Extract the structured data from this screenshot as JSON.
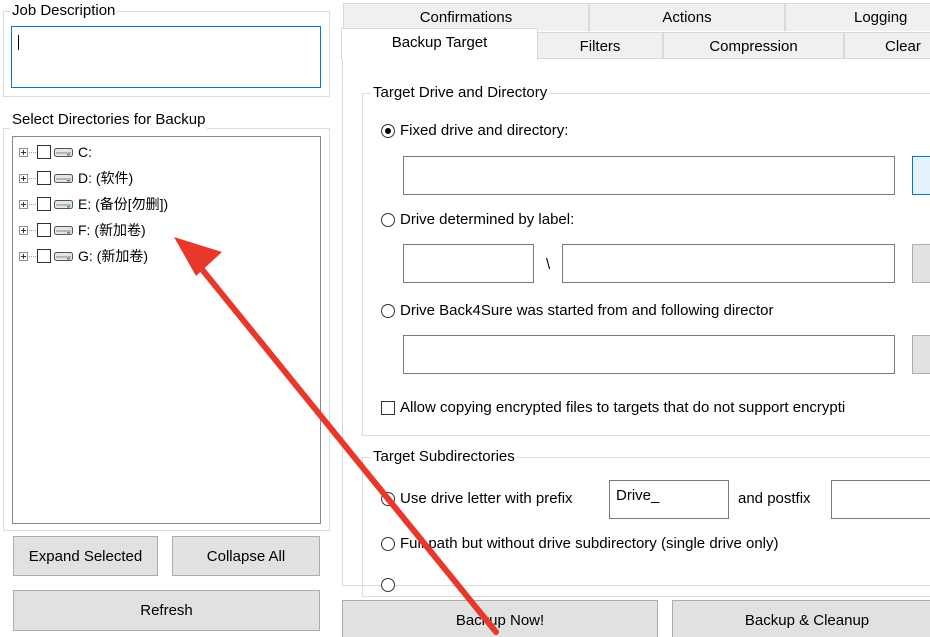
{
  "left_panel": {
    "job_description_label": "Job Description",
    "job_description_value": "",
    "select_dirs_label": "Select Directories for Backup",
    "drives": [
      {
        "label": "C:"
      },
      {
        "label": "D: (软件)"
      },
      {
        "label": "E: (备份[勿删])"
      },
      {
        "label": "F: (新加卷)"
      },
      {
        "label": "G: (新加卷)"
      }
    ],
    "expand_selected": "Expand Selected",
    "collapse_all": "Collapse All",
    "refresh": "Refresh"
  },
  "tabs": {
    "row1": [
      "Confirmations",
      "Actions",
      "Logging"
    ],
    "row2": [
      "Backup Target",
      "Filters",
      "Compression",
      "Clear"
    ],
    "active": "Backup Target"
  },
  "target_drive": {
    "group_label": "Target Drive and Directory",
    "fixed_label": "Fixed drive and directory:",
    "fixed_selected": true,
    "label_option": "Drive determined by label:",
    "separator": "\\",
    "started_from_option": "Drive Back4Sure was started from and following director",
    "encrypted_label": "Allow copying encrypted files to targets that do not support encrypti",
    "encrypted_checked": false
  },
  "target_subdirs": {
    "group_label": "Target Subdirectories",
    "use_prefix_label": "Use drive letter with prefix",
    "use_prefix_selected": true,
    "prefix_value": "Drive_",
    "postfix_label": "and postfix",
    "postfix_value": "",
    "full_path_label": "Full path but without drive subdirectory (single drive only)"
  },
  "bottom_buttons": {
    "backup_now": "Backup Now!",
    "backup_cleanup": "Backup & Cleanup"
  },
  "colors": {
    "arrow": "#e8382b",
    "focus_border": "#0078d7",
    "button_bg": "#e1e1e1"
  }
}
